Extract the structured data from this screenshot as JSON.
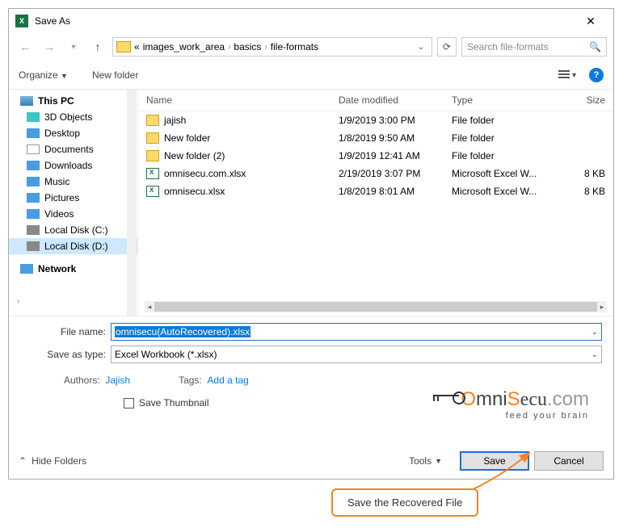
{
  "title": "Save As",
  "breadcrumb": {
    "pre": "«",
    "p1": "images_work_area",
    "p2": "basics",
    "p3": "file-formats"
  },
  "search_placeholder": "Search file-formats",
  "toolbar": {
    "organize": "Organize",
    "newfolder": "New folder"
  },
  "tree": {
    "thispc": "This PC",
    "threed": "3D Objects",
    "desktop": "Desktop",
    "documents": "Documents",
    "downloads": "Downloads",
    "music": "Music",
    "pictures": "Pictures",
    "videos": "Videos",
    "diskc": "Local Disk (C:)",
    "diskd": "Local Disk (D:)",
    "network": "Network"
  },
  "cols": {
    "name": "Name",
    "date": "Date modified",
    "type": "Type",
    "size": "Size"
  },
  "files": [
    {
      "name": "jajish",
      "date": "1/9/2019 3:00 PM",
      "type": "File folder",
      "size": "",
      "icon": "fold"
    },
    {
      "name": "New folder",
      "date": "1/8/2019 9:50 AM",
      "type": "File folder",
      "size": "",
      "icon": "fold"
    },
    {
      "name": "New folder (2)",
      "date": "1/9/2019 12:41 AM",
      "type": "File folder",
      "size": "",
      "icon": "fold"
    },
    {
      "name": "omnisecu.com.xlsx",
      "date": "2/19/2019 3:07 PM",
      "type": "Microsoft Excel W...",
      "size": "8 KB",
      "icon": "xls"
    },
    {
      "name": "omnisecu.xlsx",
      "date": "1/8/2019 8:01 AM",
      "type": "Microsoft Excel W...",
      "size": "8 KB",
      "icon": "xls"
    }
  ],
  "form": {
    "filename_label": "File name:",
    "filename_value": "omnisecu(AutoRecovered).xlsx",
    "type_label": "Save as type:",
    "type_value": "Excel Workbook (*.xlsx)",
    "authors_label": "Authors:",
    "authors_value": "Jajish",
    "tags_label": "Tags:",
    "tags_value": "Add a tag",
    "thumb": "Save Thumbnail"
  },
  "footer": {
    "hide": "Hide Folders",
    "tools": "Tools",
    "save": "Save",
    "cancel": "Cancel"
  },
  "logo": {
    "text1": "mni",
    "text2": "Secu",
    "text3": ".com",
    "sub": "feed your brain"
  },
  "callout": "Save the Recovered File"
}
